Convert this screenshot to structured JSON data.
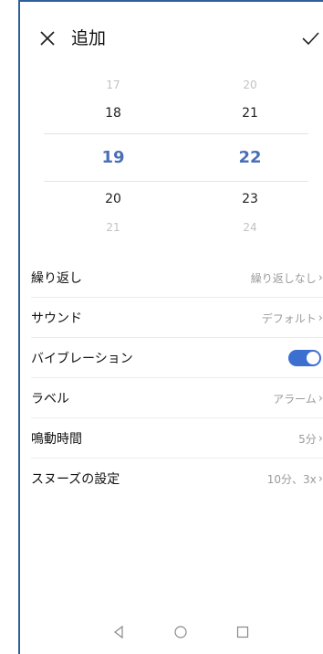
{
  "header": {
    "title": "追加",
    "close_icon": "close-icon",
    "confirm_icon": "check-icon"
  },
  "picker": {
    "hours": [
      "17",
      "18",
      "19",
      "20",
      "21"
    ],
    "minutes": [
      "20",
      "21",
      "22",
      "23",
      "24"
    ],
    "selected_hour": "19",
    "selected_minute": "22"
  },
  "settings": {
    "repeat": {
      "label": "繰り返し",
      "value": "繰り返しなし"
    },
    "sound": {
      "label": "サウンド",
      "value": "デフォルト"
    },
    "vibration": {
      "label": "バイブレーション",
      "enabled": true
    },
    "label": {
      "label": "ラベル",
      "value": "アラーム"
    },
    "duration": {
      "label": "鳴動時間",
      "value": "5分"
    },
    "snooze": {
      "label": "スヌーズの設定",
      "value": "10分、3x"
    }
  },
  "colors": {
    "accent": "#4a6fb5",
    "toggle": "#3d6fd0"
  },
  "navbar": {
    "back_icon": "back-triangle-icon",
    "home_icon": "home-circle-icon",
    "recents_icon": "recents-square-icon"
  }
}
